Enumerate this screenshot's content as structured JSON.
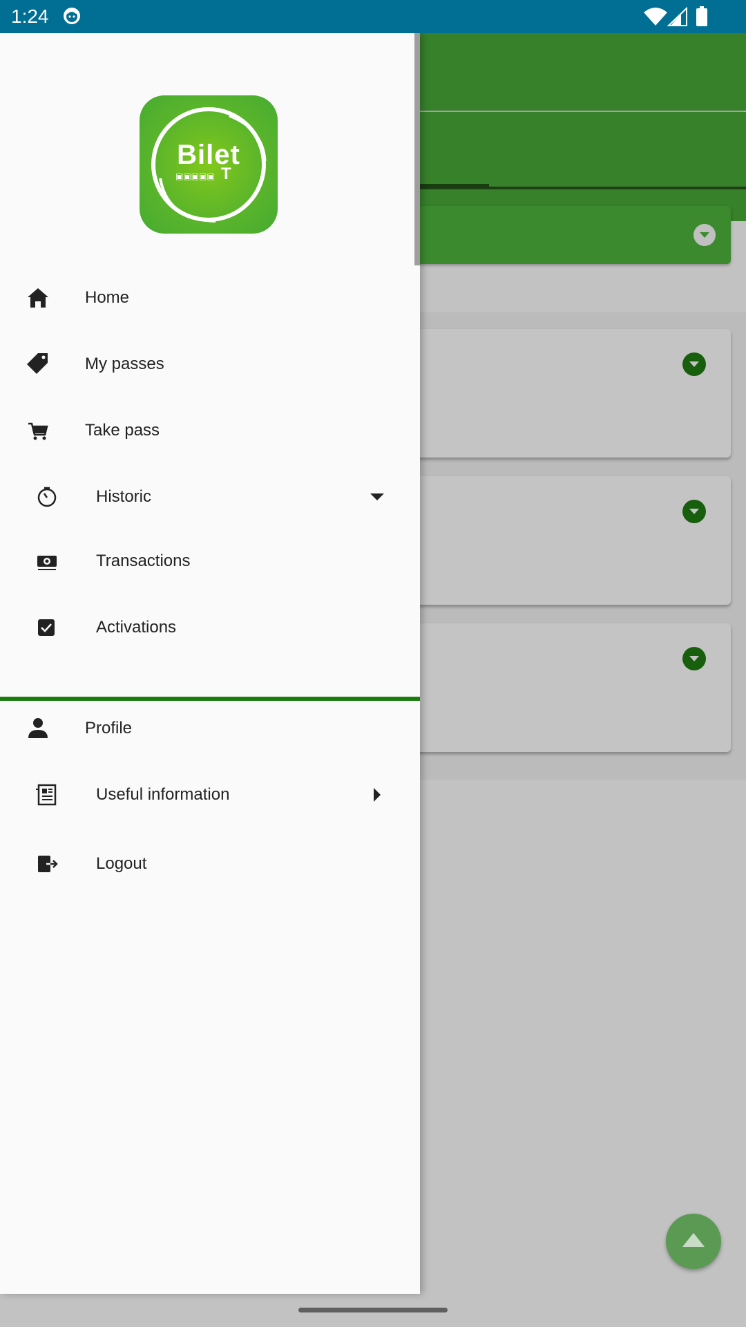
{
  "status_bar": {
    "time": "1:24",
    "icons": [
      "face-notification-icon",
      "wifi-icon",
      "signal-icon",
      "battery-icon"
    ]
  },
  "logo": {
    "text": "Bilet",
    "sub_letter": "T",
    "colors": {
      "background": "#4caf36",
      "ring": "#ffffff"
    }
  },
  "drawer": {
    "items": [
      {
        "label": "Home",
        "icon": "home-icon"
      },
      {
        "label": "My passes",
        "icon": "tag-icon"
      },
      {
        "label": "Take pass",
        "icon": "cart-icon"
      },
      {
        "label": "Historic",
        "icon": "timer-icon",
        "expanded": true
      },
      {
        "label": "Transactions",
        "icon": "money-icon"
      },
      {
        "label": "Activations",
        "icon": "checkbox-icon"
      },
      {
        "label": "Profile",
        "icon": "person-icon"
      },
      {
        "label": "Useful information",
        "icon": "newspaper-icon",
        "expanded": false
      },
      {
        "label": "Logout",
        "icon": "logout-icon"
      }
    ]
  },
  "colors": {
    "status_bar": "#006f93",
    "primary": "#37812b",
    "divider": "#1b7c10",
    "scrim": "#c2c2c2"
  }
}
